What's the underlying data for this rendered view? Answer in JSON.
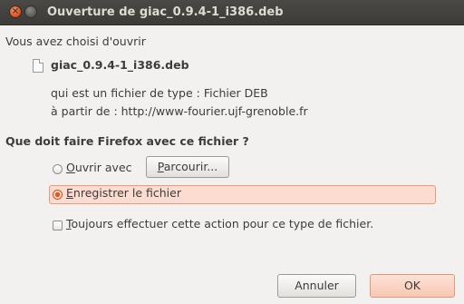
{
  "window": {
    "title": "Ouverture de giac_0.9.4-1_i386.deb"
  },
  "dialog": {
    "intro": "Vous avez choisi d'ouvrir",
    "file_name": "giac_0.9.4-1_i386.deb",
    "file_type_line": "qui est un fichier de type : Fichier DEB",
    "source_line": "à partir de : http://www-fourier.ujf-grenoble.fr",
    "question": "Que doit faire Firefox avec ce fichier ?"
  },
  "options": {
    "open_with": {
      "mnemonic": "O",
      "rest": "uvrir avec",
      "selected": false
    },
    "browse_button": {
      "mnemonic": "P",
      "rest": "arcourir..."
    },
    "save_file": {
      "mnemonic": "E",
      "rest": "nregistrer le fichier",
      "selected": true
    },
    "always_do": {
      "mnemonic": "T",
      "rest": "oujours effectuer cette action pour ce type de fichier.",
      "checked": false
    }
  },
  "buttons": {
    "cancel": "Annuler",
    "ok": "OK"
  },
  "colors": {
    "titlebar": "#3c3b37",
    "accent": "#e2581f",
    "selection_fill": "#fcdcd0",
    "background": "#f2f1f0"
  },
  "icons": [
    "close-icon",
    "minimize-icon",
    "file-icon"
  ]
}
